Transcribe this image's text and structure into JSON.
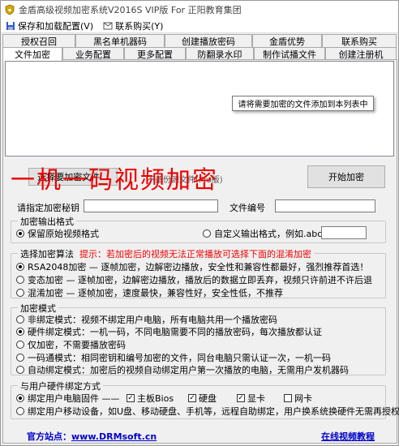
{
  "window": {
    "title": "金盾高级视频加密系统V2016S VIP版 For 正阳教育集团"
  },
  "menu": {
    "save": "保存和加载配置(V)",
    "contact": "联系购买(Y)"
  },
  "tabs_top": [
    "授权召回",
    "黑名单机器码",
    "创建播放密码",
    "金盾优势",
    "联系购买"
  ],
  "tabs_bottom": [
    "文件加密",
    "业务配置",
    "更多配置",
    "防翻录水印",
    "制作试播文件",
    "创建注册机"
  ],
  "file_list": {
    "tooltip": "请将需要加密的文件添加到本列表中"
  },
  "buttons": {
    "select": "选择要加密文件...",
    "start": "开始加密",
    "select_hidden": "不备份源文件(Pro版)"
  },
  "overlay_text": "一机一码视频加密",
  "fields": {
    "password_label": "请指定加密秘钥",
    "file_no_label": "文件编号"
  },
  "output_format": {
    "title": "加密输出格式",
    "keep": "保留原始视频格式",
    "custom": "自定义输出格式，例如.abc"
  },
  "algorithm": {
    "title": "选择加密算法",
    "tip": "提示：若加密后的视频无法正常播放可选择下面的混淆加密",
    "options": [
      "RSA2048加密 — 逐帧加密，边解密边播放，安全性和兼容性都最好，强烈推荐首选！",
      "变态加密 — 逐帧加密，边解密边播放，播放后的数据立即丢弃，视频只许前进不许后退",
      "混淆加密 — 逐帧加密，速度最快，兼容性好，安全性低，不推荐"
    ]
  },
  "mode": {
    "title": "加密模式",
    "options": [
      "非绑定模式：视频不绑定用户电脑，所有电脑共用一个播放密码",
      "硬件绑定模式：一机一码，不同电脑需要不同的播放密码，每次播放都认证",
      "仅加密，不需要播放密码",
      "一码通模式：相同密钥和编号加密的文件，同台电脑只需认证一次，一机一码",
      "自动绑定模式：加密后的视频自动绑定用户第一次播放的电脑，无需用户发机器码"
    ]
  },
  "hardware": {
    "title": "与用户硬件绑定方式",
    "fixed": "绑定用户电脑固件 ——",
    "checks": [
      "主板Bios",
      "硬盘",
      "显卡",
      "网卡"
    ],
    "mobile": "绑定用户移动设备，如U盘、移动硬盘、手机等，远程自助绑定，用户换系统换硬件无需再授权"
  },
  "footer": {
    "site_label": "官方站点：",
    "site_url": "www.DRMsoft.cn",
    "tutorial": "在线视频教程"
  }
}
